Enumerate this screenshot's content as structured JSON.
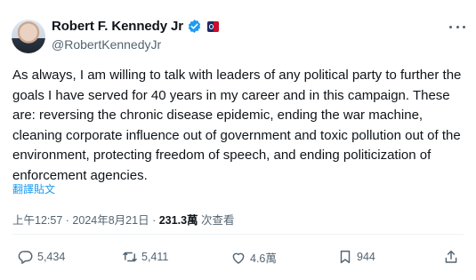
{
  "author": {
    "display_name": "Robert F. Kennedy Jr",
    "handle": "@RobertKennedyJr",
    "verified_icon": "verified-badge-icon",
    "flag_icon": "affiliate-flag-icon"
  },
  "tweet": {
    "text": "As always, I am willing to talk with leaders of any political party to further the goals I have served for 40 years in my career and in this campaign. These are: reversing the chronic disease epidemic, ending the war machine, cleaning corporate influence out of government and toxic pollution out of the environment, protecting freedom of speech, and ending politicization of enforcement agencies.",
    "translate_label": "翻譯貼文"
  },
  "meta": {
    "time": "上午12:57",
    "separator": "·",
    "date": "2024年8月21日",
    "views_count": "231.3萬",
    "views_label": "次查看"
  },
  "actions": {
    "replies": "5,434",
    "reposts": "5,411",
    "likes": "4.6萬",
    "bookmarks": "944"
  },
  "colors": {
    "accent": "#1d9bf0",
    "text": "#0f1419",
    "secondary_text": "#536471",
    "divider": "#eff3f4"
  }
}
